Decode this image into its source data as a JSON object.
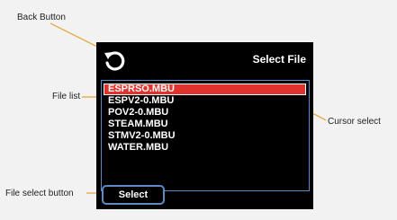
{
  "callouts": {
    "back_button": "Back Button",
    "file_list": "File list",
    "cursor_select": "Cursor select",
    "file_select_button": "File select button"
  },
  "screen": {
    "title": "Select File",
    "back_icon": "rotate-ccw-arrow-icon",
    "files": [
      {
        "name": "ESPRSO.MBU",
        "selected": true
      },
      {
        "name": "ESPV2-0.MBU",
        "selected": false
      },
      {
        "name": "POV2-0.MBU",
        "selected": false
      },
      {
        "name": "STEAM.MBU",
        "selected": false
      },
      {
        "name": "STMV2-0.MBU",
        "selected": false
      },
      {
        "name": "WATER.MBU",
        "selected": false
      }
    ],
    "select_button_label": "Select"
  },
  "colors": {
    "screen_bg": "#000000",
    "highlight": "#e0332d",
    "frame_blue": "#5d89c4",
    "leader_line": "#e8a030"
  }
}
